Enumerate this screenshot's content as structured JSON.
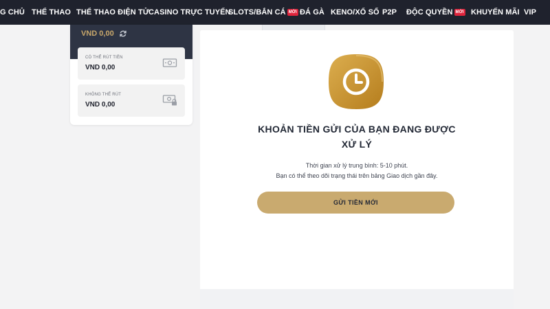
{
  "colors": {
    "nav_bg": "#1f222d",
    "badge": "#e0243c",
    "gold": "#c9aa6f",
    "icon_gold": "#c4922e"
  },
  "topnav": {
    "items": [
      {
        "label": "G CHỦ"
      },
      {
        "label": "THỂ THAO"
      },
      {
        "label": "THỂ THAO ĐIỆN TỬ"
      },
      {
        "label": "CASINO TRỰC TUYẾN"
      },
      {
        "label": "SLOTS/BẮN CÁ",
        "badge": "MỚI"
      },
      {
        "label": "ĐÁ GÀ"
      },
      {
        "label": "KENO/XỔ SỐ"
      },
      {
        "label": "P2P"
      },
      {
        "label": "ĐỘC QUYỀN",
        "badge": "MỚI"
      },
      {
        "label": "KHUYẾN MÃI"
      },
      {
        "label": "VIP"
      }
    ]
  },
  "wallet": {
    "balance": "VND 0,00",
    "refresh_icon": "refresh-icon",
    "withdrawable": {
      "label": "CÓ THỂ RÚT TIỀN",
      "value": "VND 0,00",
      "icon": "banknote-icon"
    },
    "non_withdrawable": {
      "label": "KHÔNG THỂ RÚT",
      "value": "VND 0,00",
      "icon": "locked-banknote-icon"
    }
  },
  "deposit_status": {
    "icon": "clock-icon",
    "title_line1": "KHOẢN TIỀN GỬI CỦA BẠN ĐANG ĐƯỢC",
    "title_line2": "XỬ LÝ",
    "info_line1": "Thời gian xử lý trung bình: 5-10 phút.",
    "info_line2": "Bạn có thể theo dõi trạng thái trên bảng Giao dịch gần đây.",
    "button_label": "GỬI TIỀN MỚI"
  }
}
